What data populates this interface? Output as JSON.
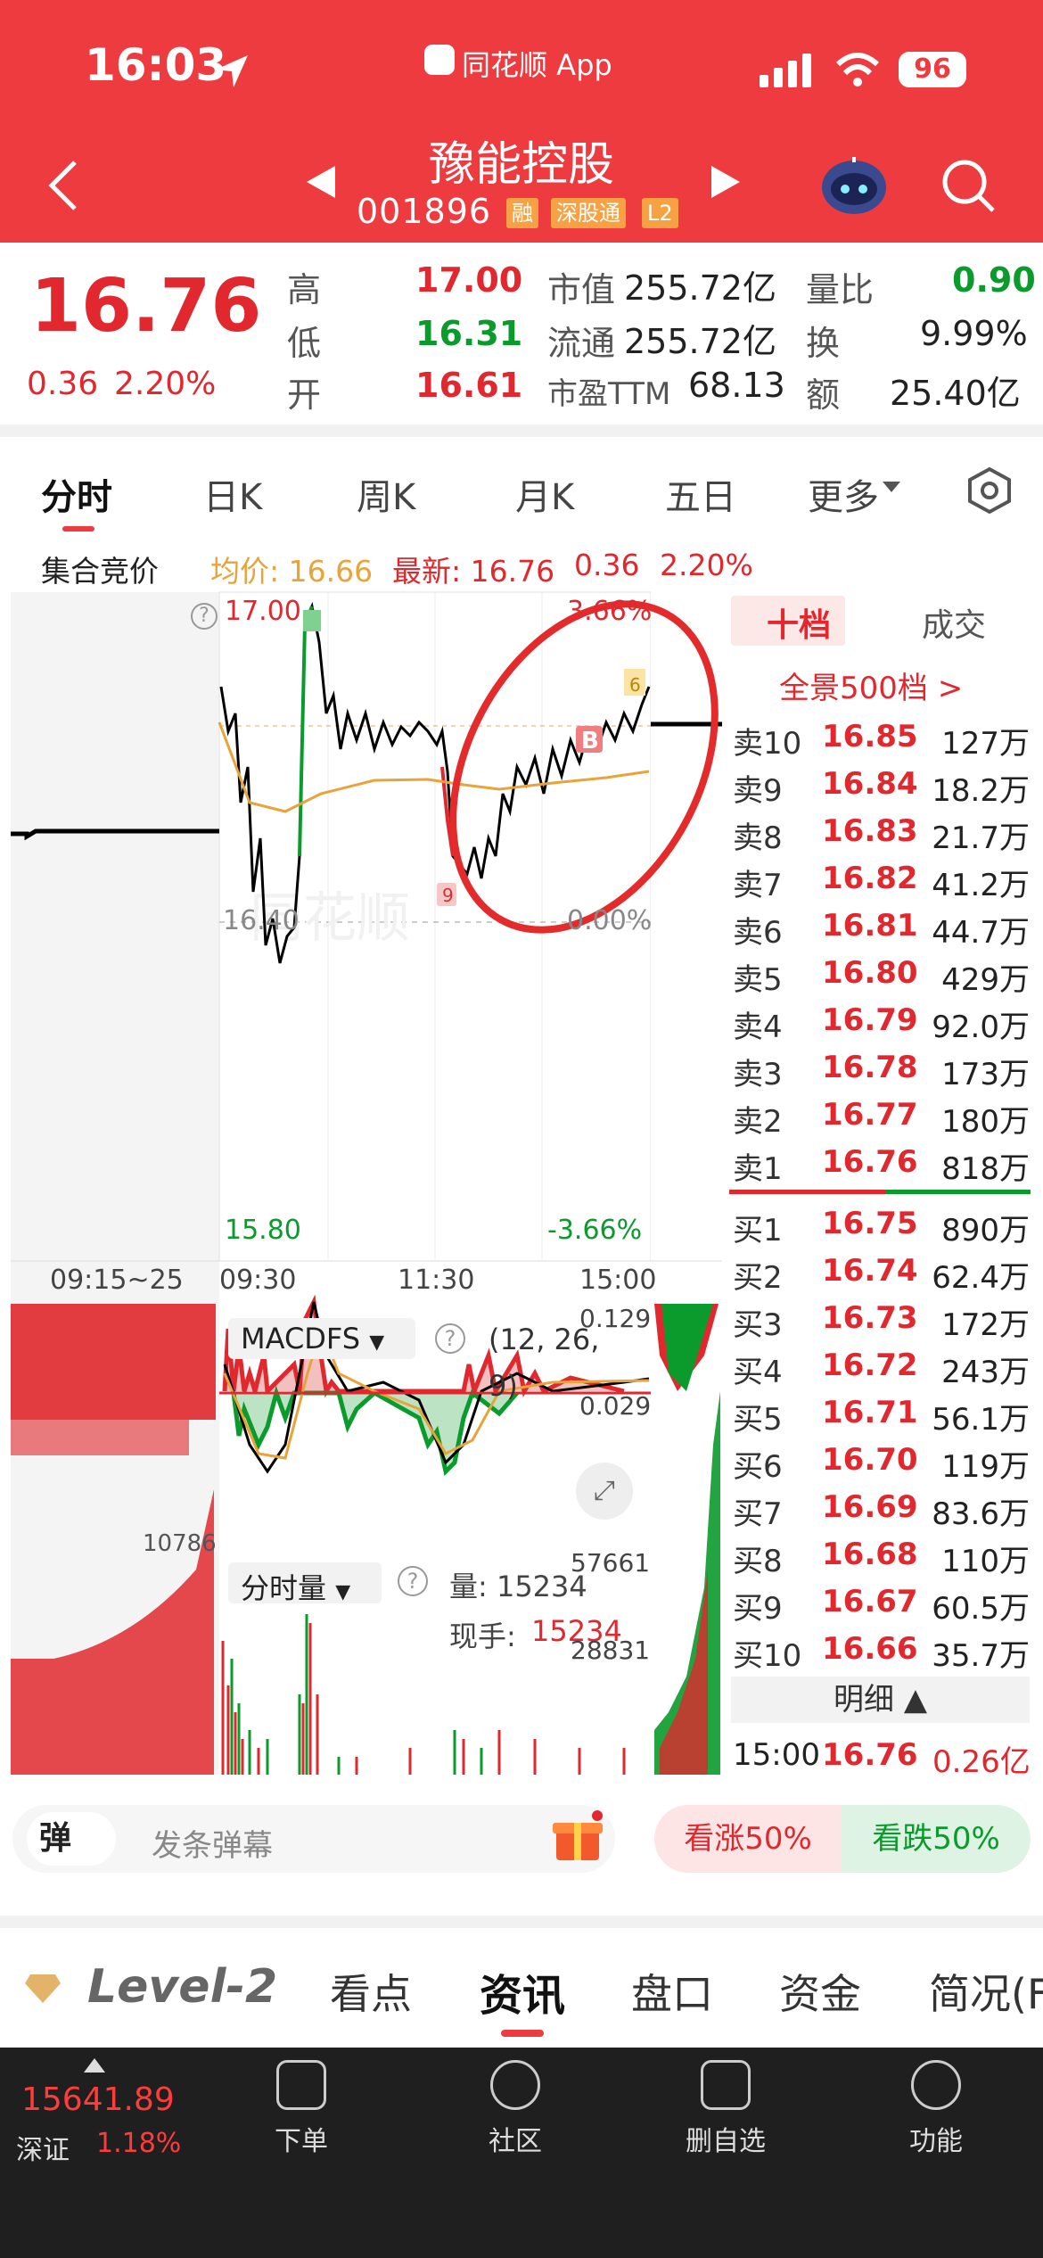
{
  "status": {
    "time": "16:03",
    "app_name": "同花顺 App",
    "battery": "96"
  },
  "header": {
    "title": "豫能控股",
    "code": "001896",
    "tags": [
      "融",
      "深股通",
      "L2"
    ]
  },
  "quote": {
    "price": "16.76",
    "change": "0.36",
    "change_pct": "2.20%",
    "high_label": "高",
    "high": "17.00",
    "low_label": "低",
    "low": "16.31",
    "open_label": "开",
    "open": "16.61",
    "mcap_label": "市值",
    "mcap": "255.72亿",
    "float_label": "流通",
    "float": "255.72亿",
    "pe_label": "市盈TTM",
    "pe": "68.13",
    "vr_label": "量比",
    "vr": "0.90",
    "turn_label": "换",
    "turn": "9.99%",
    "amt_label": "额",
    "amt": "25.40亿"
  },
  "tabs": [
    "分时",
    "日K",
    "周K",
    "月K",
    "五日",
    "更多"
  ],
  "info_bar": {
    "auction": "集合竞价",
    "avg": "均价: 16.66",
    "latest": "最新: 16.76",
    "chg": "0.36",
    "pct": "2.20%"
  },
  "chart": {
    "y_top": "17.00",
    "y_mid": "16.40",
    "y_bottom": "15.80",
    "pct_top": "3.66%",
    "pct_mid": "0.00%",
    "pct_bottom": "-3.66%",
    "times": [
      "09:15~25",
      "09:30",
      "11:30",
      "15:00"
    ],
    "markers": [
      "B",
      "9",
      "6"
    ],
    "macd_label": "MACDFS",
    "macd_params": "(12, 26, 9)",
    "macd_top": "0.129",
    "macd_mid": "0.029",
    "vol_label": "分时量",
    "vol_text": "量: 15234",
    "now_label": "现手:",
    "now_value": "15234",
    "vol_top": "57661",
    "vol_mid": "28831",
    "auction_vol": "10786",
    "watermark": "同花顺"
  },
  "orderbook": {
    "tab_active": "十档",
    "tab_other": "成交",
    "all_link": "全景500档 >",
    "sells": [
      {
        "label": "卖10",
        "price": "16.85",
        "vol": "127万"
      },
      {
        "label": "卖9",
        "price": "16.84",
        "vol": "18.2万"
      },
      {
        "label": "卖8",
        "price": "16.83",
        "vol": "21.7万"
      },
      {
        "label": "卖7",
        "price": "16.82",
        "vol": "41.2万"
      },
      {
        "label": "卖6",
        "price": "16.81",
        "vol": "44.7万"
      },
      {
        "label": "卖5",
        "price": "16.80",
        "vol": "429万"
      },
      {
        "label": "卖4",
        "price": "16.79",
        "vol": "92.0万"
      },
      {
        "label": "卖3",
        "price": "16.78",
        "vol": "173万"
      },
      {
        "label": "卖2",
        "price": "16.77",
        "vol": "180万"
      },
      {
        "label": "卖1",
        "price": "16.76",
        "vol": "818万"
      }
    ],
    "buys": [
      {
        "label": "买1",
        "price": "16.75",
        "vol": "890万"
      },
      {
        "label": "买2",
        "price": "16.74",
        "vol": "62.4万"
      },
      {
        "label": "买3",
        "price": "16.73",
        "vol": "172万"
      },
      {
        "label": "买4",
        "price": "16.72",
        "vol": "243万"
      },
      {
        "label": "买5",
        "price": "16.71",
        "vol": "56.1万"
      },
      {
        "label": "买6",
        "price": "16.70",
        "vol": "119万"
      },
      {
        "label": "买7",
        "price": "16.69",
        "vol": "83.6万"
      },
      {
        "label": "买8",
        "price": "16.68",
        "vol": "110万"
      },
      {
        "label": "买9",
        "price": "16.67",
        "vol": "60.5万"
      },
      {
        "label": "买10",
        "price": "16.66",
        "vol": "35.7万"
      }
    ],
    "detail_label": "明细 ▲",
    "last_trade": {
      "time": "15:00",
      "price": "16.76",
      "amt": "0.26亿"
    }
  },
  "danmu": {
    "icon": "弹",
    "placeholder": "发条弹幕",
    "up": "看涨50%",
    "down": "看跌50%"
  },
  "subtabs": [
    "Level-2",
    "看点",
    "资讯",
    "盘口",
    "资金",
    "简况(F"
  ],
  "bottom_nav": {
    "index_value": "15641.89",
    "index_name": "深证",
    "index_pct": "1.18%",
    "items": [
      "下单",
      "社区",
      "删自选",
      "功能"
    ]
  },
  "colors": {
    "brand": "#ee3b3f",
    "up": "#e0282e",
    "down": "#0a9b2c",
    "avg_line": "#e8a33a"
  }
}
